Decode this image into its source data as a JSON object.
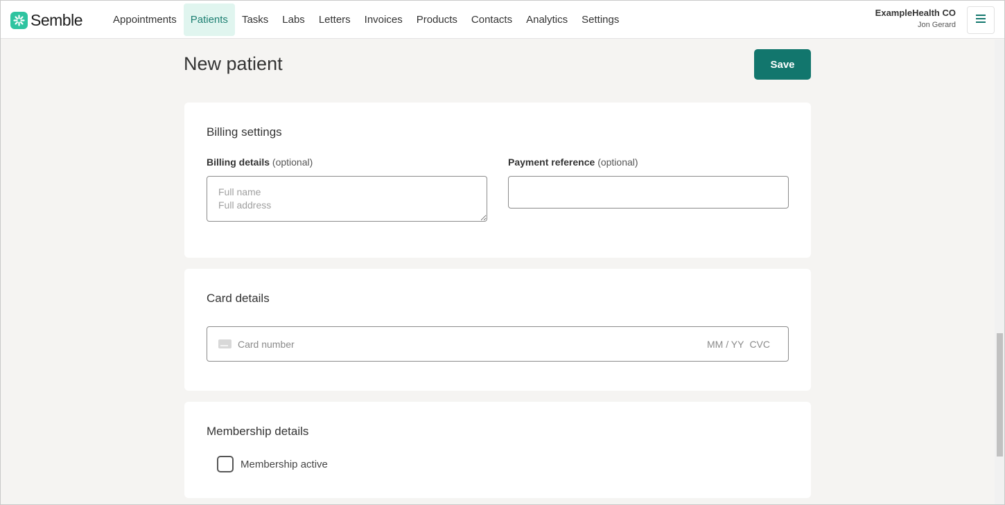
{
  "brand": {
    "name": "Semble",
    "accent": "#2ec4a0",
    "primary": "#12766d",
    "logo_icon": "semble-asterisk-icon"
  },
  "nav": {
    "items": [
      {
        "label": "Appointments"
      },
      {
        "label": "Patients",
        "active": true
      },
      {
        "label": "Tasks"
      },
      {
        "label": "Labs"
      },
      {
        "label": "Letters"
      },
      {
        "label": "Invoices"
      },
      {
        "label": "Products"
      },
      {
        "label": "Contacts"
      },
      {
        "label": "Analytics"
      },
      {
        "label": "Settings"
      }
    ]
  },
  "account": {
    "org": "ExampleHealth CO",
    "user": "Jon Gerard",
    "menu_icon": "hamburger-menu-icon"
  },
  "page": {
    "title": "New patient",
    "save_label": "Save"
  },
  "billing": {
    "title": "Billing settings",
    "details_label": "Billing details",
    "details_optional": "(optional)",
    "details_placeholder": "Full name\nFull address",
    "details_value": "",
    "reference_label": "Payment reference",
    "reference_optional": "(optional)",
    "reference_value": ""
  },
  "card": {
    "title": "Card details",
    "number_placeholder": "Card number",
    "expiry_placeholder": "MM / YY",
    "cvc_placeholder": "CVC",
    "icon": "credit-card-icon"
  },
  "membership": {
    "title": "Membership details",
    "checkbox_label": "Membership active",
    "checked": false
  }
}
